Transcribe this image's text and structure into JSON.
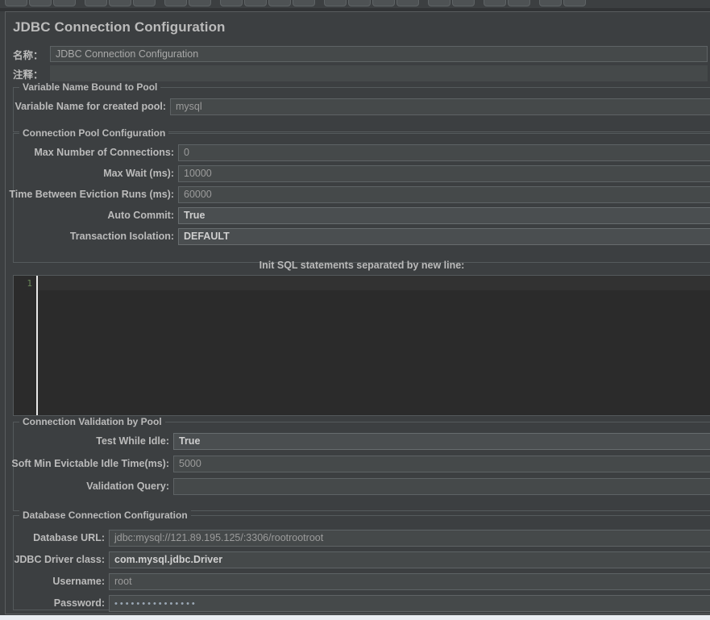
{
  "window": {
    "title": "JDBC Connection Configuration",
    "accent_color": "#bbbbbb",
    "background_color": "#3c3f41",
    "field_background_color": "#45494a",
    "editor_background_color": "#2b2b2b"
  },
  "toolbar": {
    "buttons": [
      {
        "name": "new-test-plan-button"
      },
      {
        "name": "templates-button"
      },
      {
        "name": "open-button"
      },
      {
        "name": "save-button"
      },
      {
        "name": "save-as-button"
      },
      {
        "name": "close-button"
      },
      {
        "name": "cut-button"
      },
      {
        "name": "copy-button"
      },
      {
        "name": "paste-button"
      },
      {
        "name": "expand-all-button"
      },
      {
        "name": "collapse-all-button"
      },
      {
        "name": "toggle-button"
      },
      {
        "name": "start-button"
      },
      {
        "name": "start-no-pauses-button"
      },
      {
        "name": "stop-button"
      },
      {
        "name": "shutdown-button"
      },
      {
        "name": "clear-button"
      },
      {
        "name": "clear-all-button"
      },
      {
        "name": "search-button"
      },
      {
        "name": "reset-search-button"
      },
      {
        "name": "function-helper-button"
      },
      {
        "name": "help-button"
      }
    ]
  },
  "element_meta": {
    "name_label": "名称：",
    "name_value": "JDBC Connection Configuration",
    "comment_label": "注释：",
    "comment_value": ""
  },
  "variable_pool_group": {
    "title": "Variable Name Bound to Pool",
    "fields": [
      {
        "label": "Variable Name for created pool:",
        "value": "mysql",
        "name": "variable-name-for-created-pool-field",
        "type": "text"
      }
    ]
  },
  "connection_pool_group": {
    "title": "Connection Pool Configuration",
    "fields": [
      {
        "label": "Max Number of Connections:",
        "value": "0",
        "name": "max-number-of-connections-field",
        "type": "text"
      },
      {
        "label": "Max Wait (ms):",
        "value": "10000",
        "name": "max-wait-ms-field",
        "type": "text"
      },
      {
        "label": "Time Between Eviction Runs (ms):",
        "value": "60000",
        "name": "time-between-eviction-runs-ms-field",
        "type": "text"
      },
      {
        "label": "Auto Commit:",
        "value": "True",
        "name": "auto-commit-combobox",
        "type": "combo"
      },
      {
        "label": "Transaction Isolation:",
        "value": "DEFAULT",
        "name": "transaction-isolation-combobox",
        "type": "combo"
      }
    ]
  },
  "init_sql": {
    "caption": "Init SQL statements separated by new line:",
    "line_number": "1",
    "content": ""
  },
  "connection_validation_group": {
    "title": "Connection Validation by Pool",
    "fields": [
      {
        "label": "Test While Idle:",
        "value": "True",
        "name": "test-while-idle-combobox",
        "type": "combo"
      },
      {
        "label": "Soft Min Evictable Idle Time(ms):",
        "value": "5000",
        "name": "soft-min-evictable-idle-time-ms-field",
        "type": "text"
      },
      {
        "label": "Validation Query:",
        "value": "",
        "name": "validation-query-field",
        "type": "text"
      }
    ]
  },
  "database_connection_group": {
    "title": "Database Connection Configuration",
    "fields": [
      {
        "label": "Database URL:",
        "value": "jdbc:mysql://121.89.195.125/:3306/rootrootroot",
        "name": "database-url-field",
        "type": "text"
      },
      {
        "label": "JDBC Driver class:",
        "value": "com.mysql.jdbc.Driver",
        "name": "jdbc-driver-class-combobox",
        "type": "strong"
      },
      {
        "label": "Username:",
        "value": "root",
        "name": "username-field",
        "type": "text"
      },
      {
        "label": "Password:",
        "value": "•••••••••••••••",
        "name": "password-field",
        "type": "password"
      }
    ]
  }
}
